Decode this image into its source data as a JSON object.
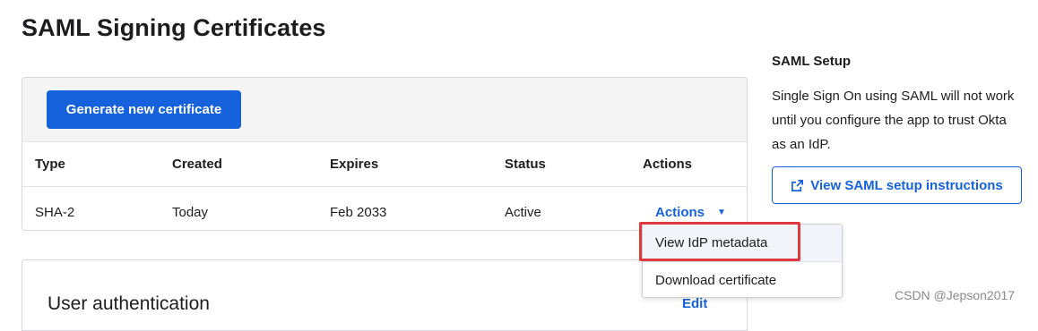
{
  "page": {
    "title": "SAML Signing Certificates"
  },
  "certificates": {
    "generate_label": "Generate new certificate",
    "columns": [
      "Type",
      "Created",
      "Expires",
      "Status",
      "Actions"
    ],
    "rows": [
      {
        "type": "SHA-2",
        "created": "Today",
        "expires": "Feb 2033",
        "status": "Active",
        "actions_label": "Actions"
      }
    ]
  },
  "actions_menu": {
    "items": [
      "View IdP metadata",
      "Download certificate"
    ],
    "highlighted_index": 0,
    "highlight_color": "#e0383f"
  },
  "user_auth": {
    "title": "User authentication",
    "edit_label": "Edit"
  },
  "sidebar": {
    "heading": "SAML Setup",
    "description": "Single Sign On using SAML will not work until you configure the app to trust Okta as an IdP.",
    "button_label": "View SAML setup instructions",
    "button_icon": "external-link-icon"
  },
  "watermark": "CSDN @Jepson2017",
  "colors": {
    "accent": "#1662dd",
    "text": "#1d1d21",
    "toolbar_bg": "#f4f4f4"
  }
}
